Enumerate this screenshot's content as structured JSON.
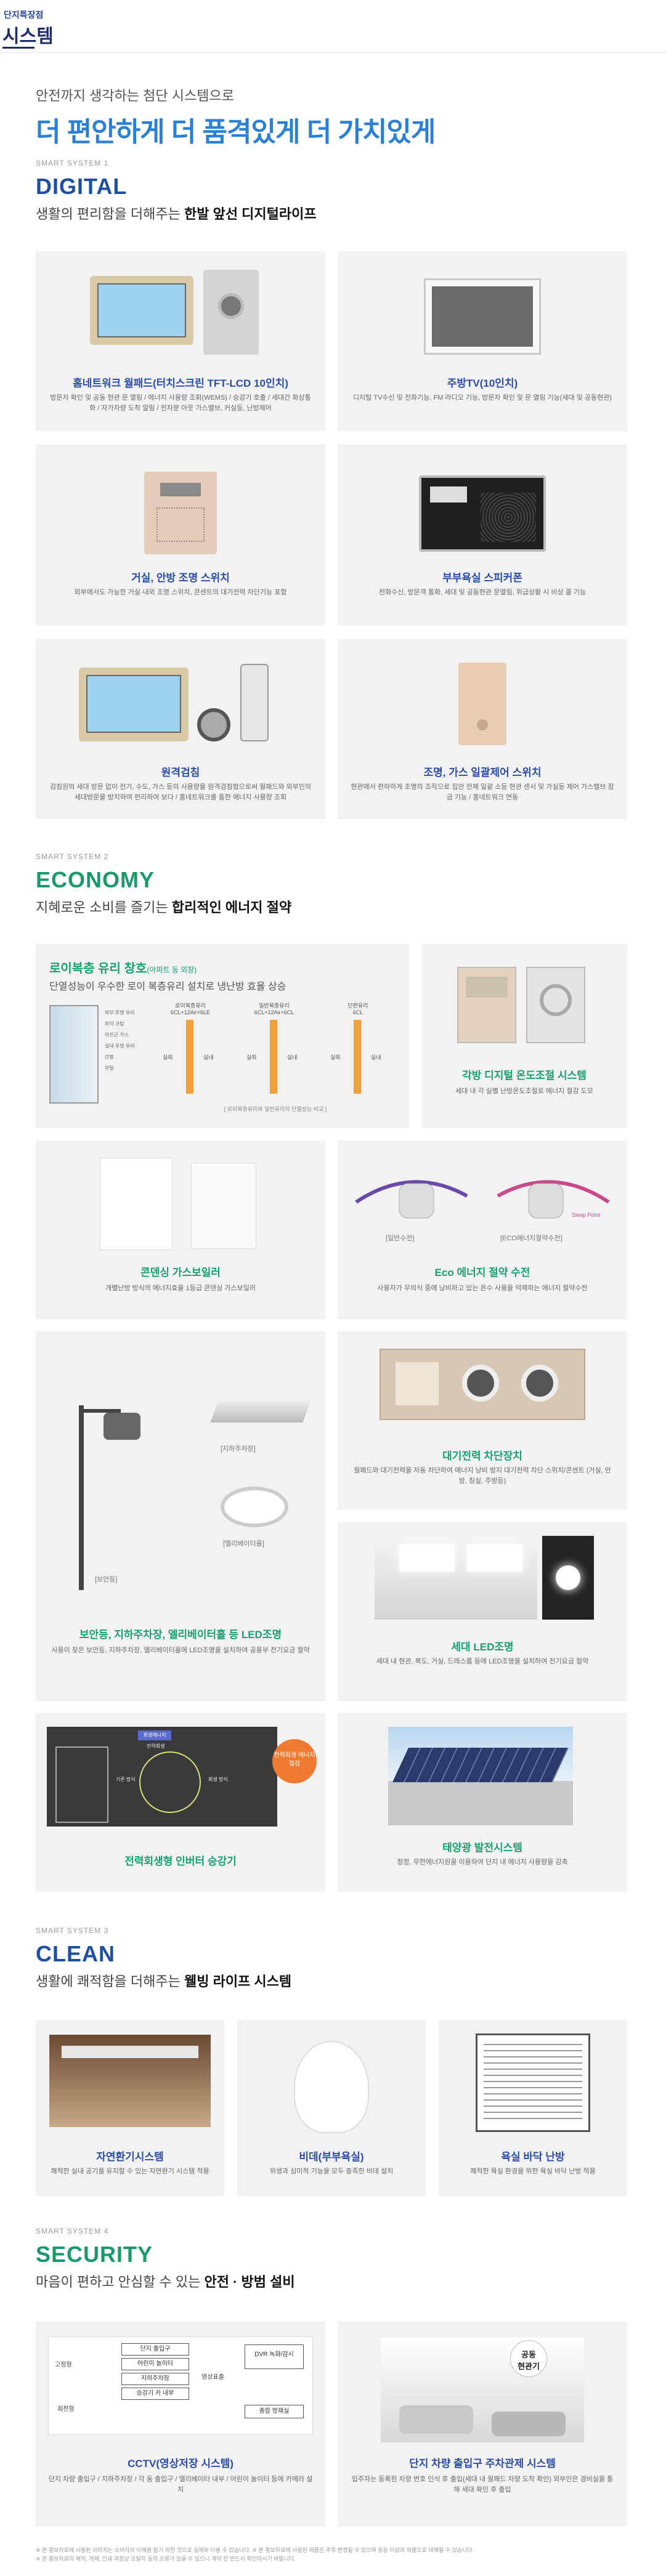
{
  "header": {
    "small": "단지특장점",
    "title": "시스템"
  },
  "hero": {
    "sub": "안전까지 생각하는 첨단 시스템으로",
    "main": "더 편안하게 더 품격있게 더 가치있게"
  },
  "digital": {
    "eyebrow": "SMART SYSTEM 1",
    "title": "DIGITAL",
    "desc_pre": "생활의 편리함을 더해주는 ",
    "desc_bold": "한발 앞선 디지털라이프",
    "cards": [
      {
        "title": "홈네트워크 월패드(터치스크린 TFT-LCD 10인치)",
        "desc": "방문자 확인 및 공동 현관 문 열림 / 에너지 사용량 조회(WEMS) / 승강기 호출 / 세대간 화상통화 / 자가차량 도착 알림 / 전자분 아웃 가스밸브, 커실등, 난방제어"
      },
      {
        "title": "주방TV(10인치)",
        "desc": "디지털 TV수신 및 전화기능, FM 라디오 기능, 방문자 확인 및 문 열림 기능(세대 및 공동현관)"
      },
      {
        "title": "거실, 안방 조명 스위치",
        "desc": "외부에서도 가능한 거실·내외 조명 스위치, 콘센트의 대기전력 차단기능 포함"
      },
      {
        "title": "부부욕실 스피커폰",
        "desc": "전화수신, 방문객 통화, 세대 및 공동현관 문열림, 위급상황 시 비상 콜 기능"
      },
      {
        "title": "원격검침",
        "desc": "검침원의 세대 방문 없이 전기, 수도, 가스 등의 사용량을 원격검침함으로써 월패드와 외부인의 세대방문을 방지하여 편리하여 보다 / 홈네트워크를 통한 에너지 사용량 조회"
      },
      {
        "title": "조명, 가스 일괄제어 스위치",
        "desc": "현관에서 편하하게 조명의 조작으로 집안 전체 일괄 소등 현관 센서 및 가실등 제어 가스밸브 잠금 기능 / 홈네트워크 연동"
      }
    ]
  },
  "economy": {
    "eyebrow": "SMART SYSTEM 2",
    "title": "ECONOMY",
    "desc_pre": "지혜로운 소비를 즐기는 ",
    "desc_bold": "합리적인 에너지 절약",
    "glass": {
      "title": "로이복층 유리 창호",
      "title_note": "(아파트 동 외창)",
      "sub": "단열성능이 우수한 로이 복층유리 설치로 냉난방 효율 상승",
      "layers": [
        "외부 투명 유리",
        "로이 코팅",
        "아르곤 가스",
        "실내 투명 유리",
        "간봉",
        "부틸"
      ],
      "columns": [
        "로이복층유리",
        "일반복층유리",
        "단판유리"
      ],
      "column_notes": [
        "6CL+12Air+6LE",
        "6CL+12Air+6CL",
        "6CL"
      ],
      "inout": [
        "실외",
        "실내"
      ],
      "note": "[ 로이복층유리와 일반유리의 단열성능 비교 ]"
    },
    "cards": [
      {
        "title": "각방 디지털 온도조절 시스템",
        "desc": "세대 내 각 실별 난방온도조절로 에너지 절감 도모"
      },
      {
        "title": "콘덴싱 가스보일러",
        "desc": "개별난방 방식의 에너지효율 1등급 콘덴싱 가스보일러"
      },
      {
        "title": "Eco 에너지 절약 수전",
        "desc": "사용자가 무의식 중에 낭비하고 있는 온수 사용을 억제하는 에너지 절약수전"
      },
      {
        "title": "보안등, 지하주차장, 엘리베이터홀 등 LED조명",
        "desc": "사용이 잦은 보안등, 지하주차장, 엘리베이터홀에 LED조명을 설치하여 공용부 전기요금 절약"
      },
      {
        "title": "대기전력 차단장치",
        "desc": "월패드와 대기전력을 자동 차단하여 에너지 낭비 방지 대기전력 차단 스위치/콘센트 (거실, 안방, 침실, 주방등)"
      },
      {
        "title": "세대 LED조명",
        "desc": "세대 내 현관, 복도, 거실, 드레스룸 등에 LED조명을 설치하여 전기요금 절약"
      },
      {
        "title": "전력회생형 인버터 승강기",
        "desc": ""
      },
      {
        "title": "태양광 발전시스템",
        "desc": "청정, 무한에너지원을 이용하여 단지 내 에너지 사용량을 감축"
      }
    ],
    "faucet_labels": [
      "[일반수전]",
      "[ECO에너지절약수전]",
      "Sleep Point"
    ],
    "led_labels": [
      "[지하주차장]",
      "[엘리베이터홀]",
      "[보안등]"
    ],
    "elevator": {
      "head": "회생에너지",
      "label1": "전력회생",
      "label2": "기존 방식",
      "label3": "회생 방식",
      "badge": "전력회생 에너지 절감"
    }
  },
  "clean": {
    "eyebrow": "SMART SYSTEM 3",
    "title": "CLEAN",
    "desc_pre": "생활에 쾌적함을 더해주는 ",
    "desc_bold": "웰빙 라이프 시스템",
    "cards": [
      {
        "title": "자연환기시스템",
        "desc": "쾌적한 실내 공기를 유지할 수 있는 자연환기 시스템 적용"
      },
      {
        "title": "비데(부부욕실)",
        "desc": "위생과 심미적 기능을 모두 충족한 비데 설치"
      },
      {
        "title": "욕실 바닥 난방",
        "desc": "쾌적한 욕실 환경을 위한 욕실 바닥 난방 적용"
      }
    ]
  },
  "security": {
    "eyebrow": "SMART SYSTEM 4",
    "title": "SECURITY",
    "desc_pre": "마음이 편하고 안심할 수 있는 ",
    "desc_bold": "안전 · 방범 설비",
    "cctv": {
      "title": "CCTV(영상저장 시스템)",
      "desc": "단지 차량 출입구 / 지하주차장 / 각 동 출입구 / 엘리베이터 내부 / 어린이 놀이터 등에 카메라 설치",
      "left": [
        "고정형",
        "회전형"
      ],
      "items": [
        "단지 출입구",
        "어린이 놀이터",
        "지하주차장",
        "승강기 카 내부"
      ],
      "center": "영상표출",
      "dvr": "DVR 녹화/감시",
      "monitor": "종합 방재실"
    },
    "parking": {
      "title": "단지 차량 출입구 주차관제 시스템",
      "desc": "입주자는 등록된 차량 번호 인식 후 출입(세대 내 월패드 차량 도착 확인) 외부인은 경비실을 통해 세대 확인 후 출입",
      "badge_line1": "공동",
      "badge_line2": "현관기"
    }
  },
  "footnote": {
    "line1": "※ 본 홍보자료에 사용된 이미지는 소비자의 이해를 돕기 위한 것으로 실제와 다를 수 있습니다. ※ 본 홍보자료에 사용된 제품은 추후 변경될 수 있으며 동등 이상의 제품으로 대체될 수 있습니다.",
    "line2": "※ 본 홍보자료의 제작, 게재, 인쇄 과정상 오탈자 등의 오류가 있을 수 있으니 계약 전 반드시 확인하시기 바랍니다."
  },
  "colors": {
    "brand_blue": "#1f4fa3",
    "brand_green": "#1a9a6a",
    "hero_blue": "#2a7fd6",
    "card_bg": "#f2f2f2"
  }
}
